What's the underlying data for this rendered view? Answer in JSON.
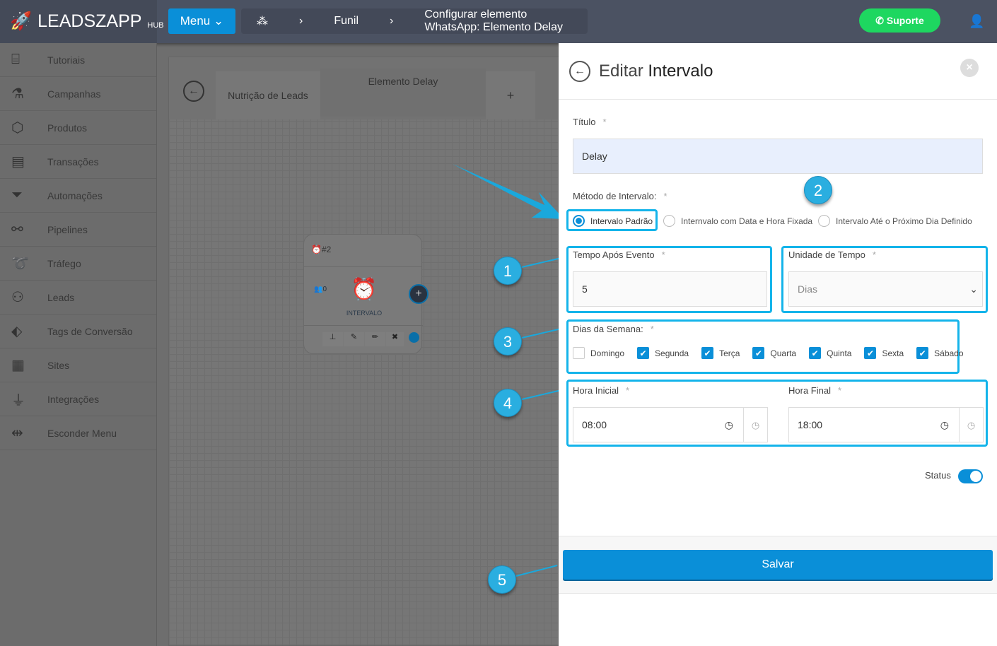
{
  "header": {
    "logo": "LEADSZAPP",
    "logo_suffix": "HUB",
    "menu": "Menu",
    "breadcrumbs": [
      "Funil",
      "Configurar elemento WhatsApp: Elemento Delay"
    ],
    "support": "Suporte"
  },
  "sidebar": {
    "items": [
      {
        "label": "Tutoriais",
        "icon": "easel-icon"
      },
      {
        "label": "Campanhas",
        "icon": "bottle-icon"
      },
      {
        "label": "Produtos",
        "icon": "box-icon"
      },
      {
        "label": "Transações",
        "icon": "card-icon"
      },
      {
        "label": "Automações",
        "icon": "funnel-icon"
      },
      {
        "label": "Pipelines",
        "icon": "share-icon"
      },
      {
        "label": "Tráfego",
        "icon": "route-icon"
      },
      {
        "label": "Leads",
        "icon": "users-icon"
      },
      {
        "label": "Tags de Conversão",
        "icon": "tag-icon"
      },
      {
        "label": "Sites",
        "icon": "site-icon"
      },
      {
        "label": "Integrações",
        "icon": "plug-icon"
      },
      {
        "label": "Esconder Menu",
        "icon": "collapse-icon"
      }
    ]
  },
  "canvas": {
    "tabs": [
      "Nutrição de Leads",
      "Elemento Delay"
    ],
    "node": {
      "id": "#2",
      "count": "0",
      "type": "INTERVALO"
    }
  },
  "panel": {
    "title_light": "Editar",
    "title_bold": "Intervalo",
    "titulo_label": "Título",
    "titulo_value": "Delay",
    "metodo_label": "Método de Intervalo:",
    "methods": [
      "Intervalo Padrão",
      "Internvalo com Data e Hora Fixada",
      "Intervalo Até o Próximo Dia Definido"
    ],
    "selected_method": "Intervalo Padrão",
    "tempo_label": "Tempo Após Evento",
    "tempo_value": "5",
    "unidade_label": "Unidade de Tempo",
    "unidade_value": "Dias",
    "dias_label": "Dias da Semana:",
    "days": [
      {
        "label": "Domingo",
        "checked": false
      },
      {
        "label": "Segunda",
        "checked": true
      },
      {
        "label": "Terça",
        "checked": true
      },
      {
        "label": "Quarta",
        "checked": true
      },
      {
        "label": "Quinta",
        "checked": true
      },
      {
        "label": "Sexta",
        "checked": true
      },
      {
        "label": "Sábado",
        "checked": true
      }
    ],
    "hora_inicial_label": "Hora Inicial",
    "hora_inicial": "08:00",
    "hora_final_label": "Hora Final",
    "hora_final": "18:00",
    "status_label": "Status",
    "status_on": true,
    "save": "Salvar",
    "required": "*"
  },
  "annotations": [
    "1",
    "2",
    "3",
    "4",
    "5"
  ],
  "colors": {
    "accent": "#0a8fd8",
    "highlight": "#14b4ea",
    "support": "#1ed760"
  }
}
